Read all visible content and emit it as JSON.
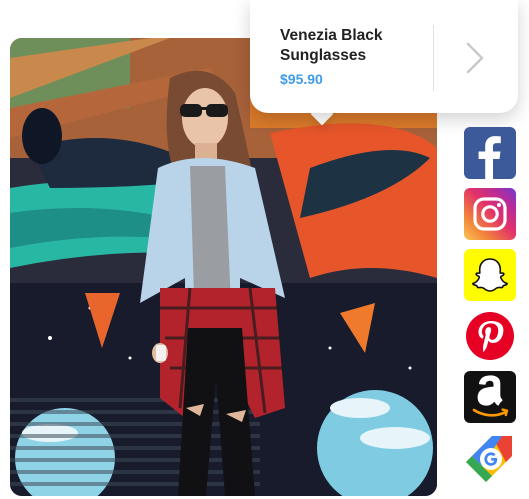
{
  "product": {
    "name": "Venezia Black Sunglasses",
    "price": "$95.90",
    "next_icon": "chevron-right-icon"
  },
  "share_icons": [
    {
      "name": "facebook-icon",
      "color": "#3c5a99"
    },
    {
      "name": "instagram-icon",
      "color": "#e2316a"
    },
    {
      "name": "snapchat-icon",
      "color": "#fffc00"
    },
    {
      "name": "pinterest-icon",
      "color": "#e60023"
    },
    {
      "name": "amazon-icon",
      "color": "#111111"
    },
    {
      "name": "google-shopping-icon",
      "color": "#4285f4"
    }
  ],
  "colors": {
    "price": "#3d9be9",
    "title": "#222222"
  }
}
